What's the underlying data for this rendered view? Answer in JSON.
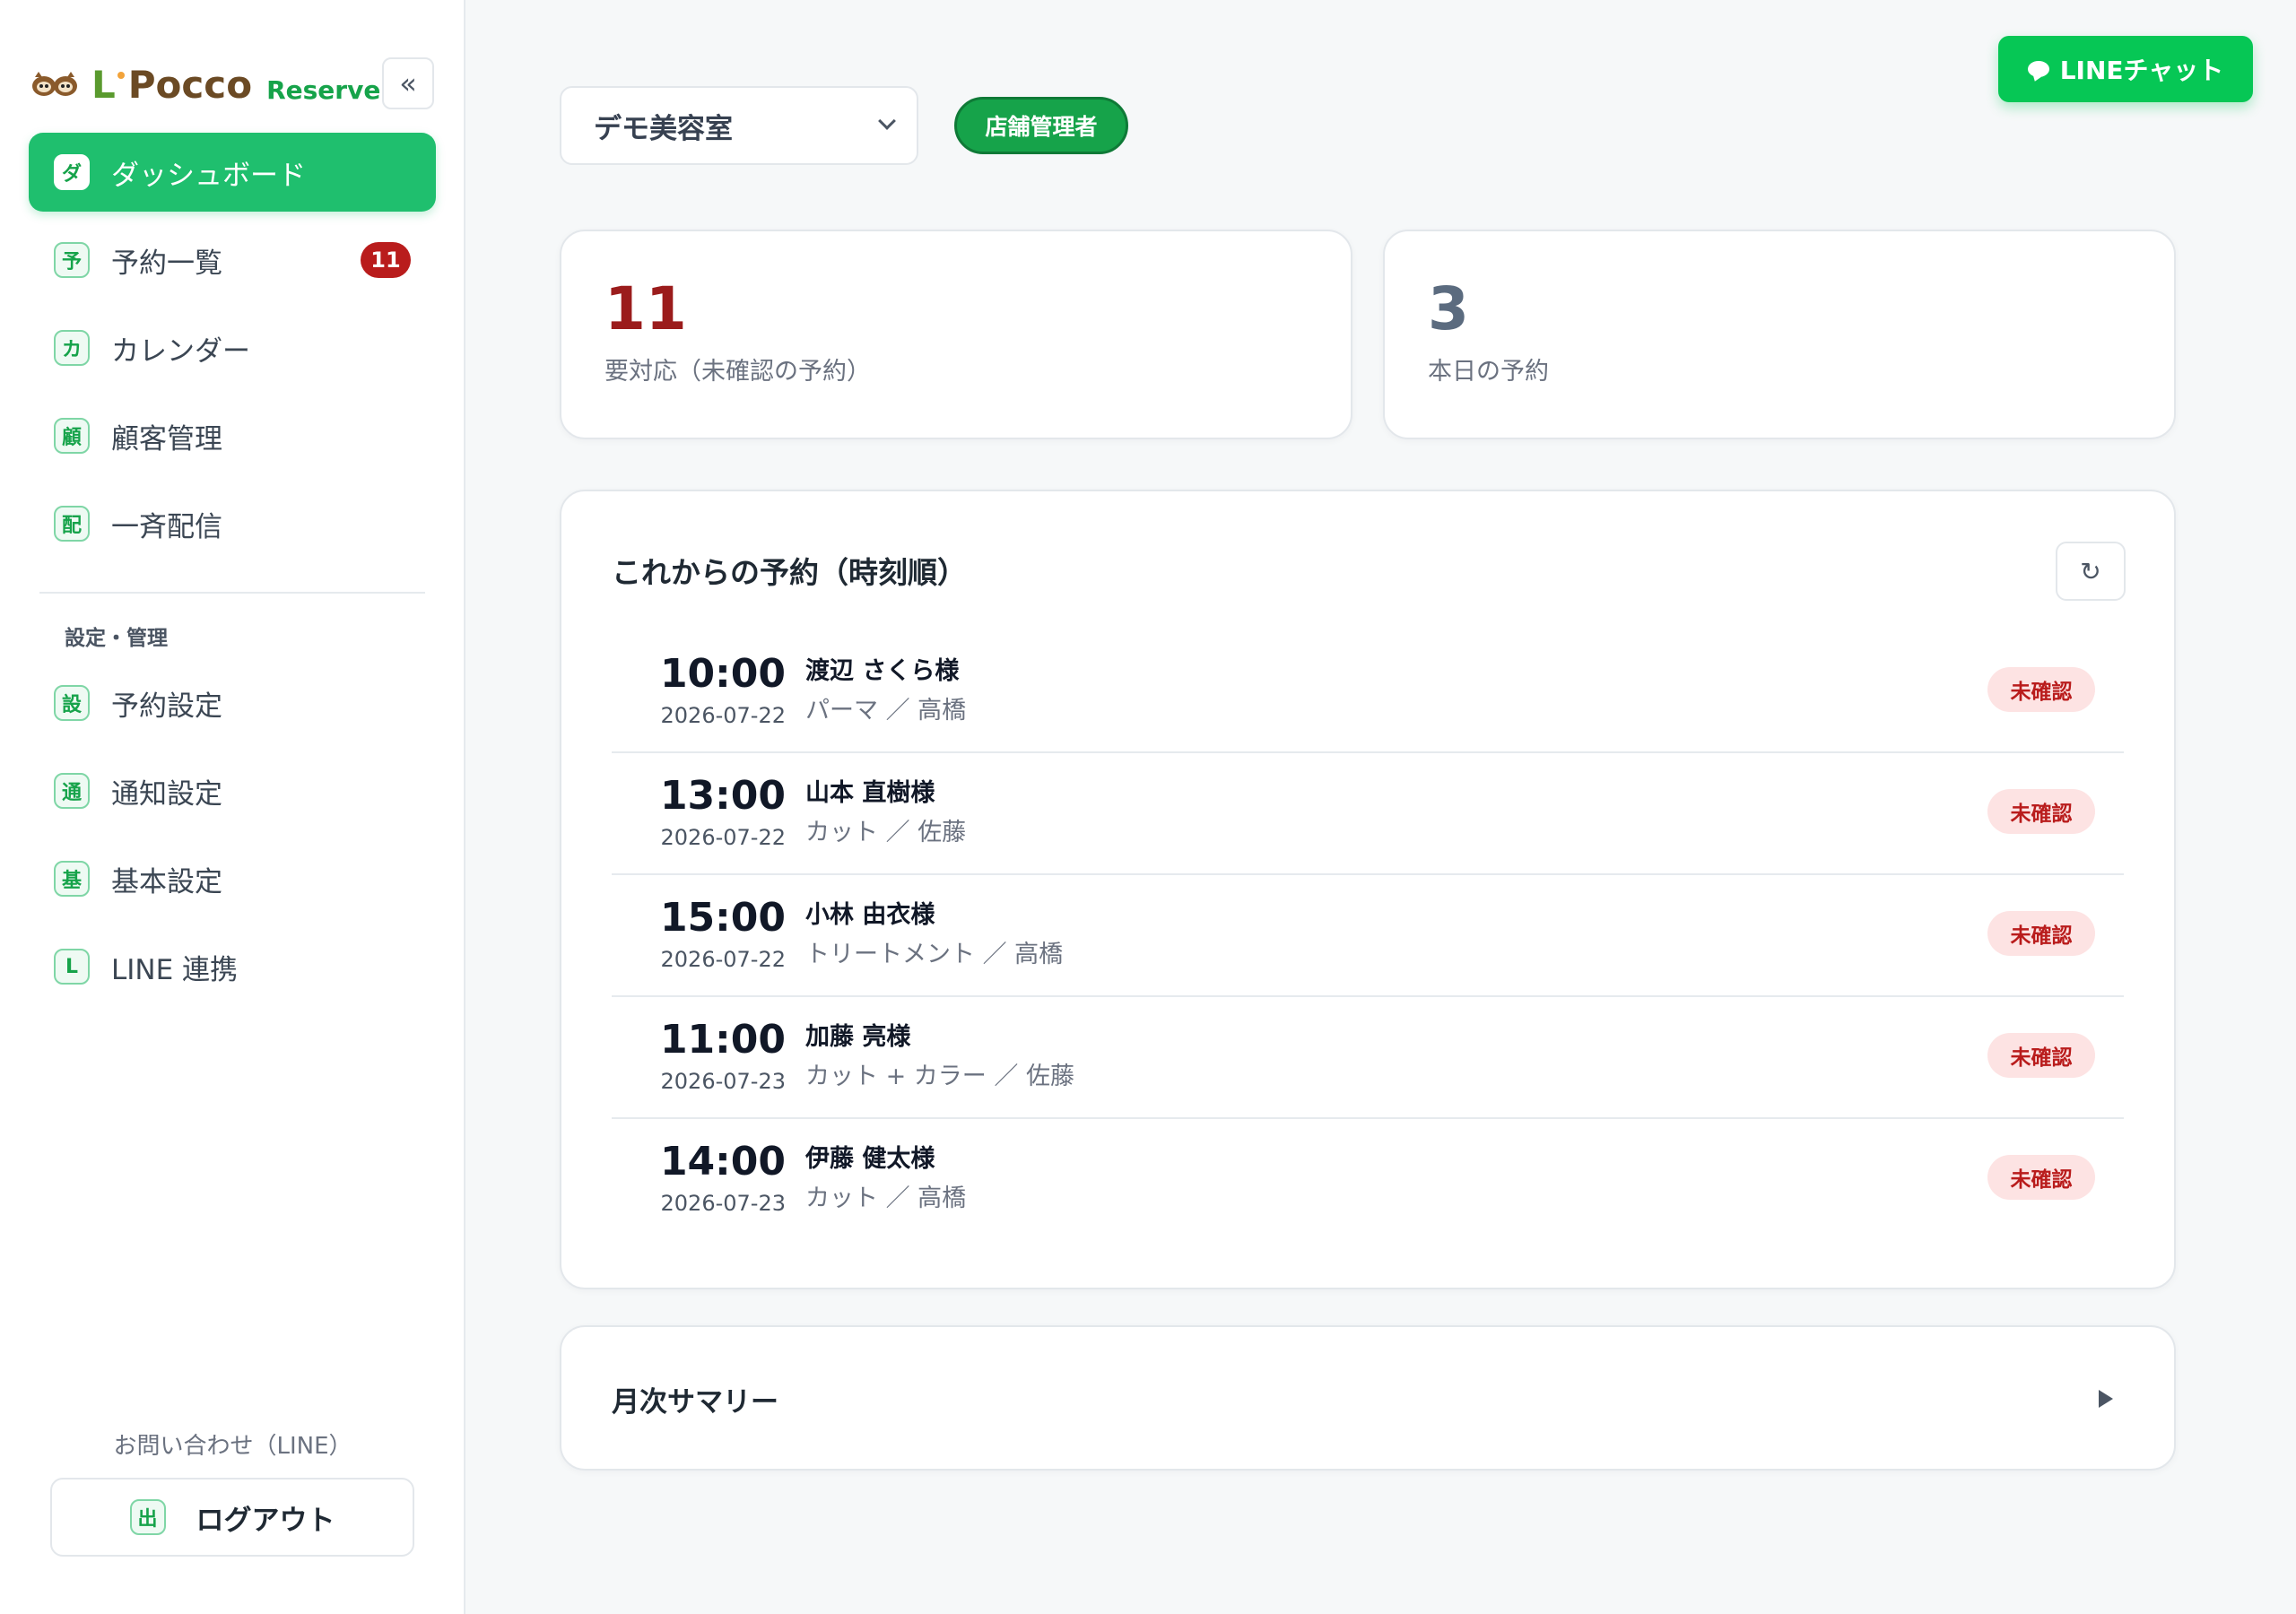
{
  "brand": {
    "letter": "L",
    "name": "Pocco",
    "product": "Reserve"
  },
  "sidebar": {
    "collapse_glyph": "«",
    "items": [
      {
        "icon": "ダ",
        "label": "ダッシュボード",
        "active": true
      },
      {
        "icon": "予",
        "label": "予約一覧",
        "badge": "11"
      },
      {
        "icon": "カ",
        "label": "カレンダー"
      },
      {
        "icon": "顧",
        "label": "顧客管理"
      },
      {
        "icon": "配",
        "label": "一斉配信"
      }
    ],
    "section_label": "設定・管理",
    "settings_items": [
      {
        "icon": "設",
        "label": "予約設定"
      },
      {
        "icon": "通",
        "label": "通知設定"
      },
      {
        "icon": "基",
        "label": "基本設定"
      },
      {
        "icon": "L",
        "label": "LINE 連携"
      }
    ],
    "contact_label": "お問い合わせ（LINE）",
    "logout": {
      "icon": "出",
      "label": "ログアウト"
    }
  },
  "header": {
    "shop_selected": "デモ美容室",
    "role": "店舗管理者",
    "line_chat_label": "LINEチャット"
  },
  "stats": [
    {
      "value": "11",
      "label": "要対応（未確認の予約）",
      "color": "#9b1c1c"
    },
    {
      "value": "3",
      "label": "本日の予約",
      "color": "#5b6b7f"
    }
  ],
  "upcoming": {
    "title": "これからの予約（時刻順）",
    "refresh_glyph": "↻",
    "rows": [
      {
        "time": "10:00",
        "date": "2026-07-22",
        "name": "渡辺 さくら様",
        "detail": "パーマ ／ 高橋",
        "status": "未確認"
      },
      {
        "time": "13:00",
        "date": "2026-07-22",
        "name": "山本 直樹様",
        "detail": "カット ／ 佐藤",
        "status": "未確認"
      },
      {
        "time": "15:00",
        "date": "2026-07-22",
        "name": "小林 由衣様",
        "detail": "トリートメント ／ 高橋",
        "status": "未確認"
      },
      {
        "time": "11:00",
        "date": "2026-07-23",
        "name": "加藤 亮様",
        "detail": "カット + カラー ／ 佐藤",
        "status": "未確認"
      },
      {
        "time": "14:00",
        "date": "2026-07-23",
        "name": "伊藤 健太様",
        "detail": "カット ／ 高橋",
        "status": "未確認"
      }
    ]
  },
  "summary": {
    "title": "月次サマリー"
  },
  "colors": {
    "accent": "#1fbf6e",
    "line_green": "#06c755",
    "danger": "#b91c1c"
  }
}
